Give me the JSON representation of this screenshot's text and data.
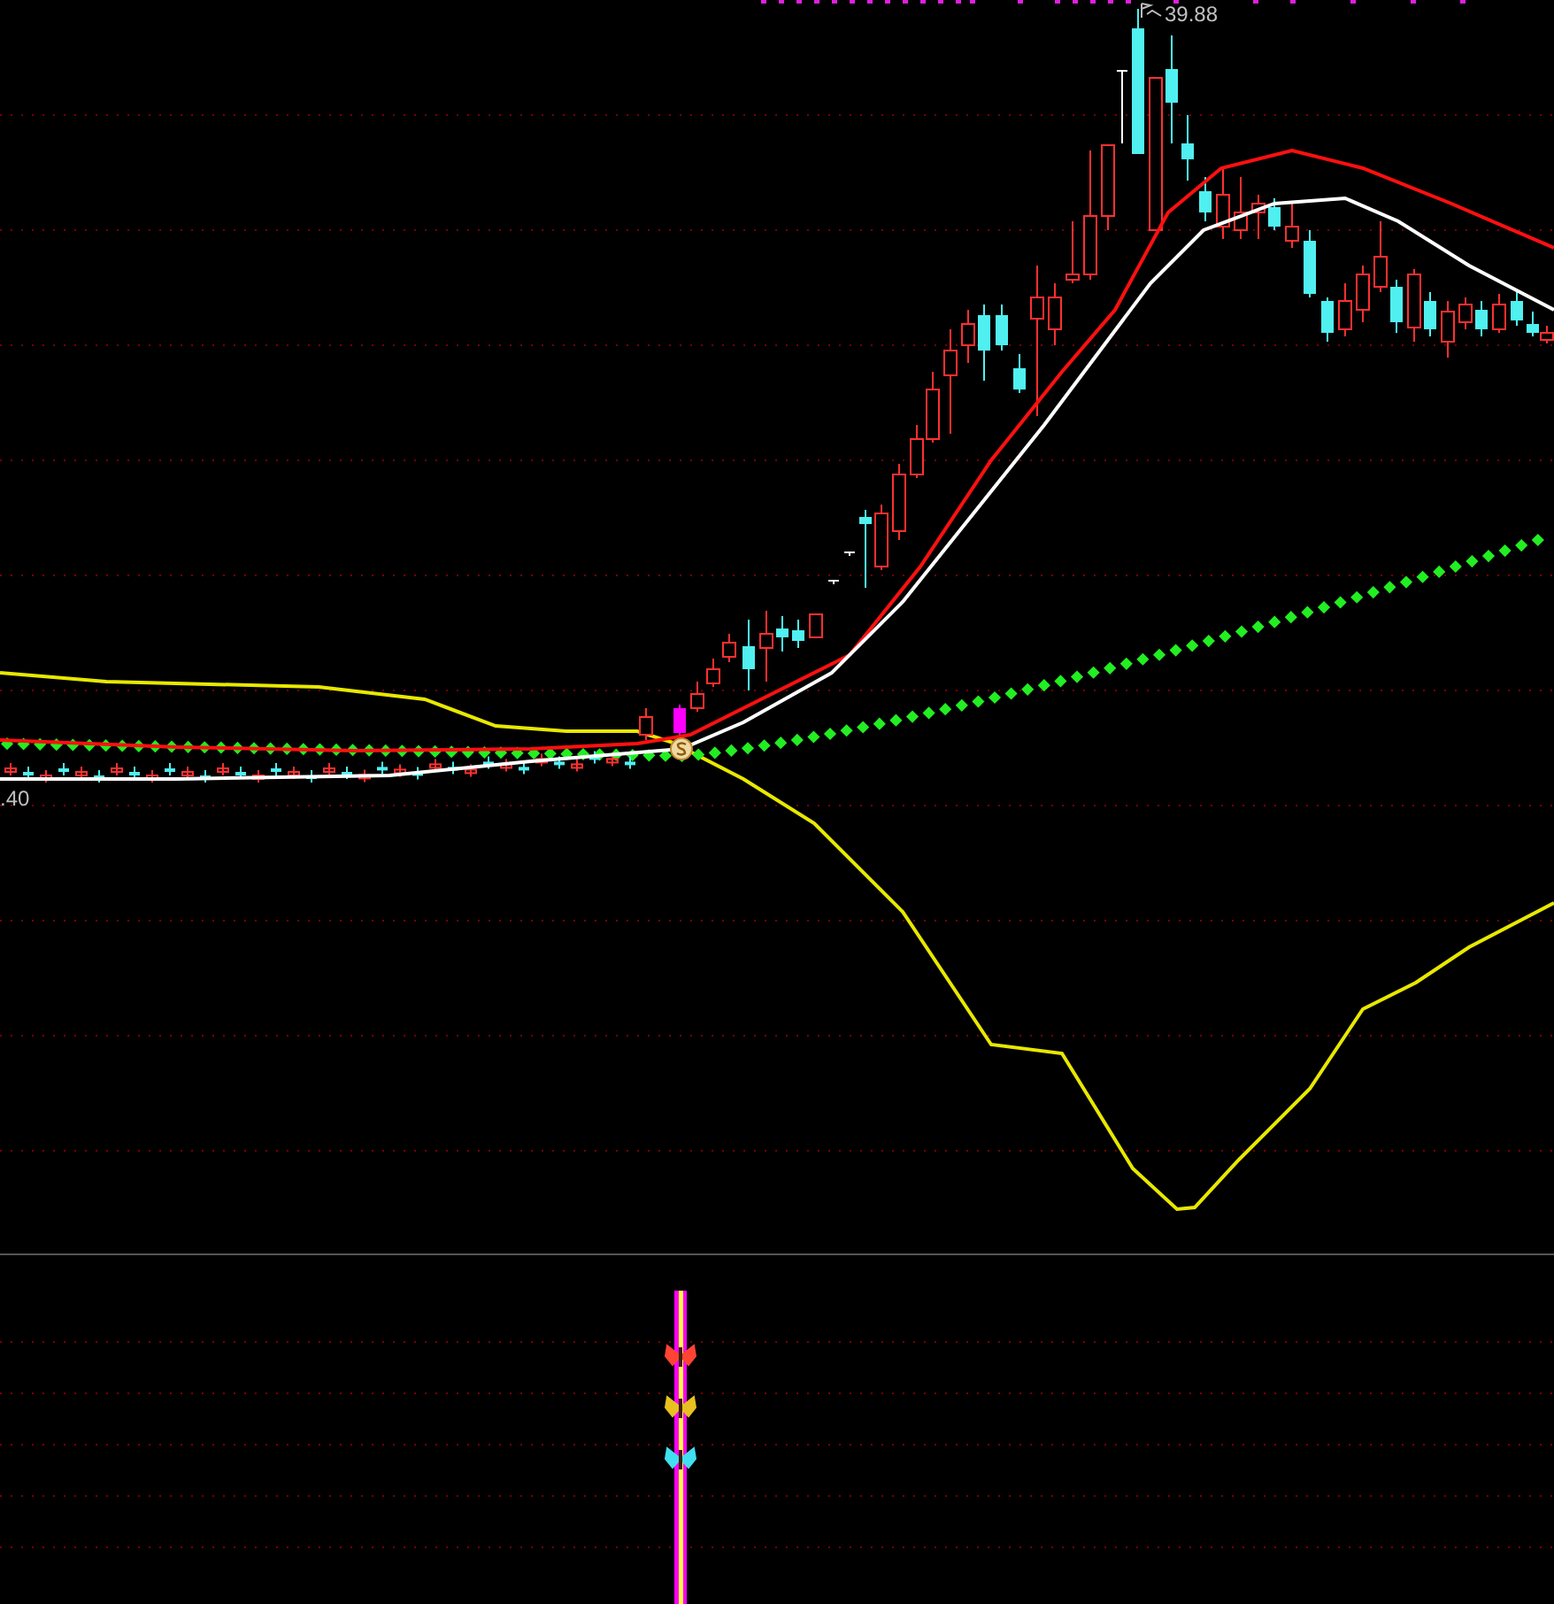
{
  "price_chart": {
    "high_label": "39.88",
    "low_label": ".40"
  },
  "signal_panel": {
    "markers": [
      {
        "color": "#ff4433"
      },
      {
        "color": "#e8c020"
      },
      {
        "color": "#40e0f0"
      }
    ]
  }
}
